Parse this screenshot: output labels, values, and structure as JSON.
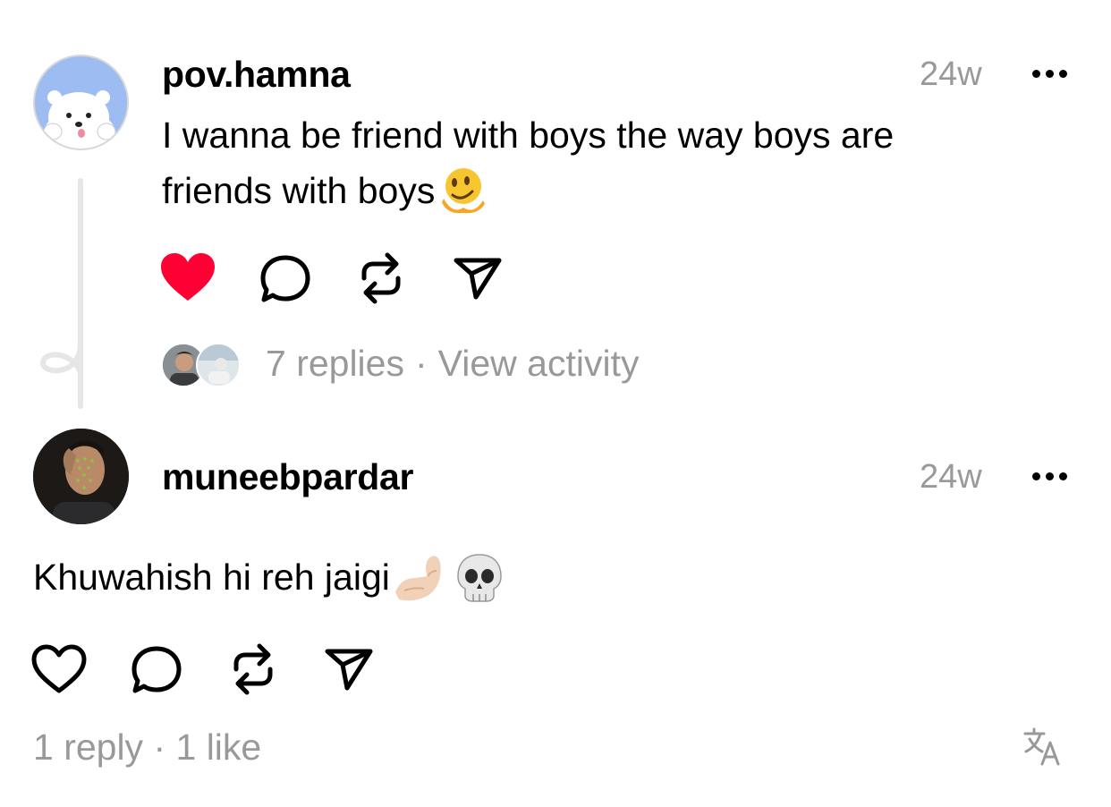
{
  "post": {
    "username": "pov.hamna",
    "time": "24w",
    "text_line1": "I wanna be friend with boys the way boys are",
    "text_line2": "friends with boys",
    "text_emoji": "melting-face-emoji",
    "liked": true,
    "replies_text": "7 replies",
    "separator": "·",
    "activity_text": "View activity"
  },
  "reply": {
    "username": "muneebpardar",
    "time": "24w",
    "text": "Khuwahish hi reh jaigi",
    "emojis": [
      "pinching-hand-emoji",
      "skull-emoji"
    ],
    "liked": false,
    "stats_text": "1 reply · 1 like"
  },
  "icons": [
    "heart-icon",
    "comment-icon",
    "repost-icon",
    "share-icon",
    "more-icon",
    "translate-icon"
  ],
  "colors": {
    "like_red": "#ff0034",
    "muted": "#999999",
    "thread_line": "#e6e6e6",
    "avatar_blue": "#9dbdf2"
  }
}
